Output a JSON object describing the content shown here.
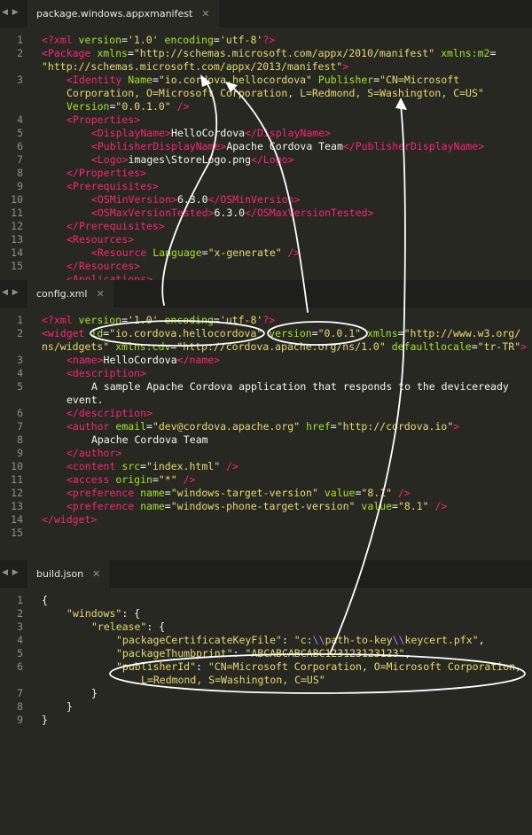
{
  "tabs": {
    "manifest": {
      "title": "package.windows.appxmanifest",
      "close": "✕",
      "arrows": "◀ ▶"
    },
    "config": {
      "title": "config.xml",
      "close": "✕",
      "arrows": "◀ ▶"
    },
    "build": {
      "title": "build.json",
      "close": "✕",
      "arrows": "◀ ▶"
    }
  },
  "manifest_lines": [
    {
      "n": "1",
      "indent": 0,
      "tokens": [
        [
          "t-tag",
          "<?xml "
        ],
        [
          "t-attr",
          "version"
        ],
        [
          "t-punc",
          "="
        ],
        [
          "t-str",
          "'1.0'"
        ],
        [
          "t-punc",
          " "
        ],
        [
          "t-attr",
          "encoding"
        ],
        [
          "t-punc",
          "="
        ],
        [
          "t-str",
          "'utf-8'"
        ],
        [
          "t-tag",
          "?>"
        ]
      ]
    },
    {
      "n": "2",
      "indent": 0,
      "tokens": [
        [
          "t-tag",
          "<Package "
        ],
        [
          "t-attr",
          "xmlns"
        ],
        [
          "t-punc",
          "="
        ],
        [
          "t-str",
          "\"http://schemas.microsoft.com/appx/2010/manifest\""
        ],
        [
          "t-punc",
          " "
        ],
        [
          "t-attr",
          "xmlns:m2"
        ],
        [
          "t-punc",
          "="
        ]
      ]
    },
    {
      "n": "",
      "indent": 0,
      "tokens": [
        [
          "t-str",
          "\"http://schemas.microsoft.com/appx/2013/manifest\""
        ],
        [
          "t-tag",
          ">"
        ]
      ]
    },
    {
      "n": "3",
      "indent": 1,
      "tokens": [
        [
          "t-tag",
          "<Identity "
        ],
        [
          "t-attr",
          "Name"
        ],
        [
          "t-punc",
          "="
        ],
        [
          "t-str",
          "\"io.cordova.hellocordova\""
        ],
        [
          "t-punc",
          " "
        ],
        [
          "t-attr",
          "Publisher"
        ],
        [
          "t-punc",
          "="
        ],
        [
          "t-str",
          "\"CN=Microsoft"
        ]
      ]
    },
    {
      "n": "",
      "indent": 1,
      "tokens": [
        [
          "t-str",
          "Corporation, O=Microsoft Corporation, L=Redmond, S=Washington, C=US\""
        ]
      ]
    },
    {
      "n": "",
      "indent": 1,
      "tokens": [
        [
          "t-attr",
          "Version"
        ],
        [
          "t-punc",
          "="
        ],
        [
          "t-str",
          "\"0.0.1.0\""
        ],
        [
          "t-tag",
          " />"
        ]
      ]
    },
    {
      "n": "4",
      "indent": 1,
      "tokens": [
        [
          "t-tag",
          "<Properties>"
        ]
      ]
    },
    {
      "n": "5",
      "indent": 2,
      "tokens": [
        [
          "t-tag",
          "<DisplayName>"
        ],
        [
          "t-text",
          "HelloCordova"
        ],
        [
          "t-tag",
          "</DisplayName>"
        ]
      ]
    },
    {
      "n": "6",
      "indent": 2,
      "tokens": [
        [
          "t-tag",
          "<PublisherDisplayName>"
        ],
        [
          "t-text",
          "Apache Cordova Team"
        ],
        [
          "t-tag",
          "</PublisherDisplayName>"
        ]
      ]
    },
    {
      "n": "7",
      "indent": 2,
      "tokens": [
        [
          "t-tag",
          "<Logo>"
        ],
        [
          "t-text",
          "images\\StoreLogo.png"
        ],
        [
          "t-tag",
          "</Logo>"
        ]
      ]
    },
    {
      "n": "8",
      "indent": 1,
      "tokens": [
        [
          "t-tag",
          "</Properties>"
        ]
      ]
    },
    {
      "n": "9",
      "indent": 1,
      "tokens": [
        [
          "t-tag",
          "<Prerequisites>"
        ]
      ]
    },
    {
      "n": "10",
      "indent": 2,
      "tokens": [
        [
          "t-tag",
          "<OSMinVersion>"
        ],
        [
          "t-text",
          "6.3.0"
        ],
        [
          "t-tag",
          "</OSMinVersion>"
        ]
      ]
    },
    {
      "n": "11",
      "indent": 2,
      "tokens": [
        [
          "t-tag",
          "<OSMaxVersionTested>"
        ],
        [
          "t-text",
          "6.3.0"
        ],
        [
          "t-tag",
          "</OSMaxVersionTested>"
        ]
      ]
    },
    {
      "n": "12",
      "indent": 1,
      "tokens": [
        [
          "t-tag",
          "</Prerequisites>"
        ]
      ]
    },
    {
      "n": "13",
      "indent": 1,
      "tokens": [
        [
          "t-tag",
          "<Resources>"
        ]
      ]
    },
    {
      "n": "14",
      "indent": 2,
      "tokens": [
        [
          "t-tag",
          "<Resource "
        ],
        [
          "t-attr",
          "Language"
        ],
        [
          "t-punc",
          "="
        ],
        [
          "t-str",
          "\"x-generate\""
        ],
        [
          "t-tag",
          " />"
        ]
      ]
    },
    {
      "n": "15",
      "indent": 1,
      "tokens": [
        [
          "t-tag",
          "</Resources>"
        ]
      ]
    },
    {
      "n": "",
      "indent": 1,
      "tokens": [
        [
          "t-tag",
          "<Applications>"
        ]
      ]
    }
  ],
  "config_lines": [
    {
      "n": "1",
      "indent": 0,
      "tokens": [
        [
          "t-tag",
          "<?xml "
        ],
        [
          "t-attr",
          "version"
        ],
        [
          "t-punc",
          "="
        ],
        [
          "t-str",
          "'1.0'"
        ],
        [
          "t-punc",
          " "
        ],
        [
          "t-attr",
          "encoding"
        ],
        [
          "t-punc",
          "="
        ],
        [
          "t-str",
          "'utf-8'"
        ],
        [
          "t-tag",
          "?>"
        ]
      ]
    },
    {
      "n": "2",
      "indent": 0,
      "tokens": [
        [
          "t-tag",
          "<widget "
        ],
        [
          "t-attr",
          "id"
        ],
        [
          "t-punc",
          "="
        ],
        [
          "t-str",
          "\"io.cordova.hellocordova\""
        ],
        [
          "t-punc",
          " "
        ],
        [
          "t-attr",
          "version"
        ],
        [
          "t-punc",
          "="
        ],
        [
          "t-str",
          "\"0.0.1\""
        ],
        [
          "t-punc",
          " "
        ],
        [
          "t-attr",
          "xmlns"
        ],
        [
          "t-punc",
          "="
        ],
        [
          "t-str",
          "\"http://www.w3.org/"
        ]
      ]
    },
    {
      "n": "",
      "indent": 0,
      "tokens": [
        [
          "t-str",
          "ns/widgets\""
        ],
        [
          "t-punc",
          " "
        ],
        [
          "t-attr",
          "xmlns:cdv"
        ],
        [
          "t-punc",
          "="
        ],
        [
          "t-str",
          "\"http://cordova.apache.org/ns/1.0\""
        ],
        [
          "t-punc",
          " "
        ],
        [
          "t-attr",
          "defaultlocale"
        ],
        [
          "t-punc",
          "="
        ],
        [
          "t-str",
          "\"tr-TR\""
        ],
        [
          "t-tag",
          ">"
        ]
      ]
    },
    {
      "n": "3",
      "indent": 1,
      "tokens": [
        [
          "t-tag",
          "<name>"
        ],
        [
          "t-text",
          "HelloCordova"
        ],
        [
          "t-tag",
          "</name>"
        ]
      ]
    },
    {
      "n": "4",
      "indent": 1,
      "tokens": [
        [
          "t-tag",
          "<description>"
        ]
      ]
    },
    {
      "n": "5",
      "indent": 2,
      "tokens": [
        [
          "t-text",
          "A sample Apache Cordova application that responds to the deviceready"
        ]
      ]
    },
    {
      "n": "",
      "indent": 1,
      "tokens": [
        [
          "t-text",
          "event."
        ]
      ]
    },
    {
      "n": "6",
      "indent": 1,
      "tokens": [
        [
          "t-tag",
          "</description>"
        ]
      ]
    },
    {
      "n": "7",
      "indent": 1,
      "tokens": [
        [
          "t-tag",
          "<author "
        ],
        [
          "t-attr",
          "email"
        ],
        [
          "t-punc",
          "="
        ],
        [
          "t-str",
          "\"dev@cordova.apache.org\""
        ],
        [
          "t-punc",
          " "
        ],
        [
          "t-attr",
          "href"
        ],
        [
          "t-punc",
          "="
        ],
        [
          "t-str",
          "\"http://cordova.io\""
        ],
        [
          "t-tag",
          ">"
        ]
      ]
    },
    {
      "n": "8",
      "indent": 2,
      "tokens": [
        [
          "t-text",
          "Apache Cordova Team"
        ]
      ]
    },
    {
      "n": "9",
      "indent": 1,
      "tokens": [
        [
          "t-tag",
          "</author>"
        ]
      ]
    },
    {
      "n": "10",
      "indent": 1,
      "tokens": [
        [
          "t-tag",
          "<content "
        ],
        [
          "t-attr",
          "src"
        ],
        [
          "t-punc",
          "="
        ],
        [
          "t-str",
          "\"index.html\""
        ],
        [
          "t-tag",
          " />"
        ]
      ]
    },
    {
      "n": "11",
      "indent": 1,
      "tokens": [
        [
          "t-tag",
          "<access "
        ],
        [
          "t-attr",
          "origin"
        ],
        [
          "t-punc",
          "="
        ],
        [
          "t-str",
          "\"*\""
        ],
        [
          "t-tag",
          " />"
        ]
      ]
    },
    {
      "n": "12",
      "indent": 1,
      "tokens": [
        [
          "t-tag",
          "<preference "
        ],
        [
          "t-attr",
          "name"
        ],
        [
          "t-punc",
          "="
        ],
        [
          "t-str",
          "\"windows-target-version\""
        ],
        [
          "t-punc",
          " "
        ],
        [
          "t-attr",
          "value"
        ],
        [
          "t-punc",
          "="
        ],
        [
          "t-str",
          "\"8.1\""
        ],
        [
          "t-tag",
          " />"
        ]
      ]
    },
    {
      "n": "13",
      "indent": 1,
      "tokens": [
        [
          "t-tag",
          "<preference "
        ],
        [
          "t-attr",
          "name"
        ],
        [
          "t-punc",
          "="
        ],
        [
          "t-str",
          "\"windows-phone-target-version\""
        ],
        [
          "t-punc",
          " "
        ],
        [
          "t-attr",
          "value"
        ],
        [
          "t-punc",
          "="
        ],
        [
          "t-str",
          "\"8.1\""
        ],
        [
          "t-tag",
          " />"
        ]
      ]
    },
    {
      "n": "14",
      "indent": 0,
      "tokens": [
        [
          "t-tag",
          "</widget>"
        ]
      ]
    },
    {
      "n": "15",
      "indent": 0,
      "tokens": []
    }
  ],
  "build_lines": [
    {
      "n": "1",
      "indent": 0,
      "tokens": [
        [
          "t-punc",
          "{"
        ]
      ]
    },
    {
      "n": "2",
      "indent": 1,
      "tokens": [
        [
          "t-key",
          "\"windows\""
        ],
        [
          "t-punc",
          ": {"
        ]
      ]
    },
    {
      "n": "3",
      "indent": 2,
      "tokens": [
        [
          "t-key",
          "\"release\""
        ],
        [
          "t-punc",
          ": {"
        ]
      ]
    },
    {
      "n": "4",
      "indent": 3,
      "tokens": [
        [
          "t-key",
          "\"packageCertificateKeyFile\""
        ],
        [
          "t-punc",
          ": "
        ],
        [
          "t-str",
          "\"c:"
        ],
        [
          "t-esc",
          "\\\\"
        ],
        [
          "t-str",
          "path-to-key"
        ],
        [
          "t-esc",
          "\\\\"
        ],
        [
          "t-str",
          "keycert.pfx\""
        ],
        [
          "t-punc",
          ","
        ]
      ]
    },
    {
      "n": "5",
      "indent": 3,
      "tokens": [
        [
          "t-key",
          "\"packageThumbprint\""
        ],
        [
          "t-punc",
          ": "
        ],
        [
          "t-str",
          "\"ABCABCABCABC123123123123\""
        ],
        [
          "t-punc",
          ","
        ]
      ]
    },
    {
      "n": "6",
      "indent": 3,
      "tokens": [
        [
          "t-key",
          "\"publisherId\""
        ],
        [
          "t-punc",
          ": "
        ],
        [
          "t-str",
          "\"CN=Microsoft Corporation, O=Microsoft Corporation,"
        ]
      ]
    },
    {
      "n": "",
      "indent": 4,
      "tokens": [
        [
          "t-str",
          "L=Redmond, S=Washington, C=US\""
        ]
      ]
    },
    {
      "n": "7",
      "indent": 2,
      "tokens": [
        [
          "t-punc",
          "}"
        ]
      ]
    },
    {
      "n": "8",
      "indent": 1,
      "tokens": [
        [
          "t-punc",
          "}"
        ]
      ]
    },
    {
      "n": "9",
      "indent": 0,
      "tokens": [
        [
          "t-punc",
          "}"
        ]
      ]
    }
  ],
  "colors": {
    "background": "#272822",
    "tag": "#f92672",
    "attribute": "#a6e22e",
    "string": "#e6db74",
    "text": "#f8f8f2",
    "line_number": "#8f908a",
    "annotation": "#ffffff"
  },
  "icons": [
    "close-icon",
    "tab-scroll-arrows-icon"
  ]
}
